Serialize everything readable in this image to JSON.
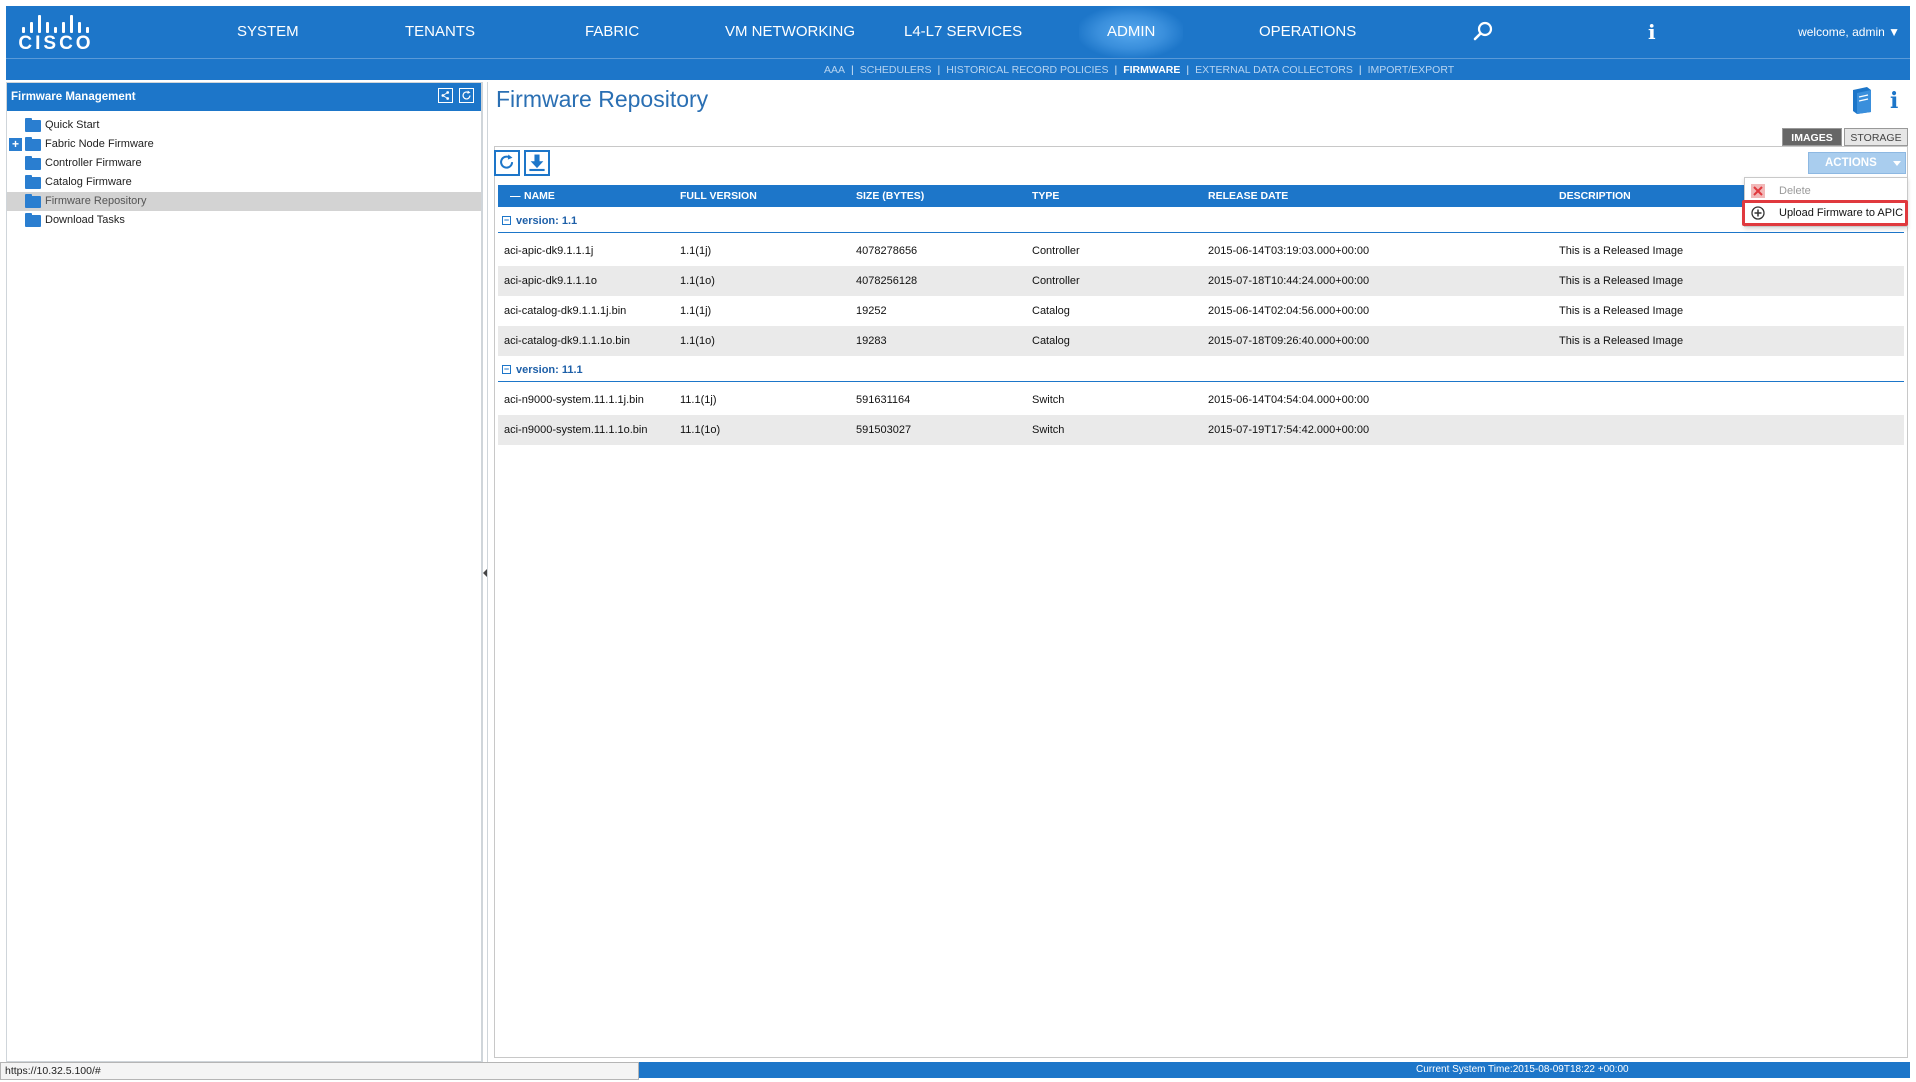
{
  "brand": {
    "wordmark": "CISCO",
    "logo_icon": "cisco-bars-logo"
  },
  "nav": {
    "items": [
      {
        "label": "SYSTEM"
      },
      {
        "label": "TENANTS"
      },
      {
        "label": "FABRIC"
      },
      {
        "label": "VM NETWORKING"
      },
      {
        "label": "L4-L7 SERVICES"
      },
      {
        "label": "ADMIN",
        "active": true
      },
      {
        "label": "OPERATIONS"
      }
    ],
    "search_icon": "search-icon",
    "info_label": "i",
    "welcome": "welcome, admin ▼"
  },
  "subnav": {
    "items": [
      {
        "label": "AAA"
      },
      {
        "label": "SCHEDULERS"
      },
      {
        "label": "HISTORICAL RECORD POLICIES"
      },
      {
        "label": "FIRMWARE",
        "active": true
      },
      {
        "label": "EXTERNAL DATA COLLECTORS"
      },
      {
        "label": "IMPORT/EXPORT"
      }
    ],
    "separator": "|"
  },
  "sidebar": {
    "title": "Firmware Management",
    "items": [
      {
        "label": "Quick Start"
      },
      {
        "label": "Fabric Node Firmware",
        "expandable": true
      },
      {
        "label": "Controller Firmware"
      },
      {
        "label": "Catalog Firmware"
      },
      {
        "label": "Firmware Repository",
        "selected": true
      },
      {
        "label": "Download Tasks"
      }
    ],
    "expander_symbol": "+"
  },
  "main": {
    "title": "Firmware Repository",
    "info_label": "i",
    "tabs": [
      {
        "label": "IMAGES",
        "active": true
      },
      {
        "label": "STORAGE"
      }
    ],
    "actions_label": "ACTIONS",
    "table": {
      "sort_indicator": "—",
      "columns": [
        "NAME",
        "FULL VERSION",
        "SIZE (BYTES)",
        "TYPE",
        "RELEASE DATE",
        "DESCRIPTION"
      ],
      "groups": [
        {
          "label": "version: 1.1",
          "toggle": "−",
          "rows": [
            [
              "aci-apic-dk9.1.1.1j",
              "1.1(1j)",
              "4078278656",
              "Controller",
              "2015-06-14T03:19:03.000+00:00",
              "This is a Released Image"
            ],
            [
              "aci-apic-dk9.1.1.1o",
              "1.1(1o)",
              "4078256128",
              "Controller",
              "2015-07-18T10:44:24.000+00:00",
              "This is a Released Image"
            ],
            [
              "aci-catalog-dk9.1.1.1j.bin",
              "1.1(1j)",
              "19252",
              "Catalog",
              "2015-06-14T02:04:56.000+00:00",
              "This is a Released Image"
            ],
            [
              "aci-catalog-dk9.1.1.1o.bin",
              "1.1(1o)",
              "19283",
              "Catalog",
              "2015-07-18T09:26:40.000+00:00",
              "This is a Released Image"
            ]
          ]
        },
        {
          "label": "version: 11.1",
          "toggle": "−",
          "rows": [
            [
              "aci-n9000-system.11.1.1j.bin",
              "11.1(1j)",
              "591631164",
              "Switch",
              "2015-06-14T04:54:04.000+00:00",
              ""
            ],
            [
              "aci-n9000-system.11.1.1o.bin",
              "11.1(1o)",
              "591503027",
              "Switch",
              "2015-07-19T17:54:42.000+00:00",
              ""
            ]
          ]
        }
      ]
    },
    "menu": {
      "items": [
        {
          "label": "Delete",
          "icon": "delete-icon",
          "disabled": true
        },
        {
          "label": "Upload Firmware to APIC",
          "icon": "plus-circle-icon",
          "highlighted": true
        }
      ]
    }
  },
  "footer": {
    "status_url": "https://10.32.5.100/#",
    "system_time": "Current System Time:2015-08-09T18:22 +00:00"
  },
  "colors": {
    "brand_blue": "#1d76c9",
    "highlight_red": "#e0393e",
    "selected_row": "#d3d3d3",
    "alt_row": "#eaeaea"
  }
}
